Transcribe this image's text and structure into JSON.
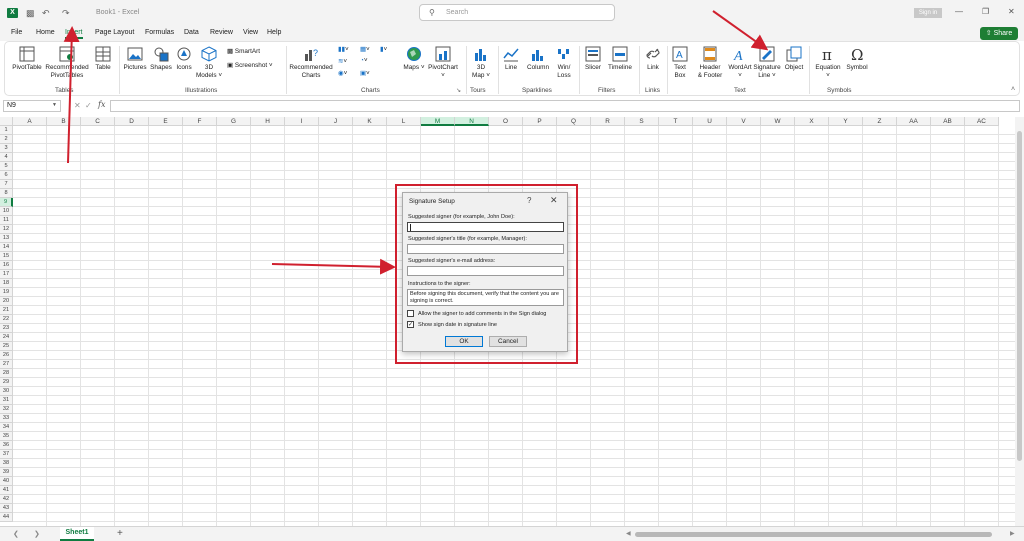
{
  "titlebar": {
    "app_icon": "X",
    "title": "Book1 - Excel",
    "search_placeholder": "Search",
    "sign_in": "Sign in",
    "icons": [
      "excel-logo-icon",
      "save-icon",
      "undo-icon",
      "redo-icon",
      "minimize-icon",
      "restore-icon",
      "close-icon"
    ]
  },
  "menu": {
    "tabs": [
      "File",
      "Home",
      "Insert",
      "Page Layout",
      "Formulas",
      "Data",
      "Review",
      "View",
      "Help"
    ],
    "active_tab": "Insert",
    "share_label": "Share"
  },
  "ribbon": {
    "pivottable": "PivotTable",
    "recommended_pivot_1": "Recommended",
    "recommended_pivot_2": "PivotTables",
    "table": "Table",
    "group_tables": "Tables",
    "pictures": "Pictures",
    "shapes": "Shapes",
    "icons": "Icons",
    "models_1": "3D",
    "models_2": "Models",
    "smartart": "SmartArt",
    "screenshot": "Screenshot",
    "group_illustrations": "Illustrations",
    "rec_charts_1": "Recommended",
    "rec_charts_2": "Charts",
    "group_charts": "Charts",
    "maps": "Maps",
    "pivotchart": "PivotChart",
    "map3d_1": "3D",
    "map3d_2": "Map",
    "group_tours": "Tours",
    "line": "Line",
    "column": "Column",
    "winloss_1": "Win/",
    "winloss_2": "Loss",
    "group_sparklines": "Sparklines",
    "slicer": "Slicer",
    "timeline": "Timeline",
    "group_filters": "Filters",
    "link": "Link",
    "group_links": "Links",
    "textbox_1": "Text",
    "textbox_2": "Box",
    "header_1": "Header",
    "header_2": "& Footer",
    "wordart": "WordArt",
    "sigline_1": "Signature",
    "sigline_2": "Line",
    "object": "Object",
    "group_text": "Text",
    "equation": "Equation",
    "symbol": "Symbol",
    "group_symbols": "Symbols"
  },
  "formula_bar": {
    "name_box": "N9",
    "fx": "fx",
    "formula": ""
  },
  "grid": {
    "columns": [
      "A",
      "B",
      "C",
      "D",
      "E",
      "F",
      "G",
      "H",
      "I",
      "J",
      "K",
      "L",
      "M",
      "N",
      "O",
      "P",
      "Q",
      "R",
      "S",
      "T",
      "U",
      "V",
      "W",
      "X",
      "Y",
      "Z",
      "AA",
      "AB",
      "AC"
    ],
    "selected_columns": [
      "M",
      "N"
    ],
    "row_count": 44,
    "selected_row": 9
  },
  "sheets": {
    "tabs": [
      "Sheet1"
    ],
    "add": "+"
  },
  "dialog": {
    "title": "Signature Setup",
    "help": "?",
    "close": "✕",
    "signer_label": "Suggested signer (for example, John Doe):",
    "signer_value": "",
    "title_label": "Suggested signer's title (for example, Manager):",
    "title_value": "",
    "email_label": "Suggested signer's e-mail address:",
    "email_value": "",
    "instructions_label": "Instructions to the signer:",
    "instructions_value": "Before signing this document, verify that the content you are signing is correct.",
    "allow_comments_label": "Allow the signer to add comments in the Sign dialog",
    "allow_comments_checked": false,
    "show_date_label": "Show sign date in signature line",
    "show_date_checked": true,
    "ok": "OK",
    "cancel": "Cancel"
  },
  "annotations": {
    "color": "#d0202e"
  }
}
